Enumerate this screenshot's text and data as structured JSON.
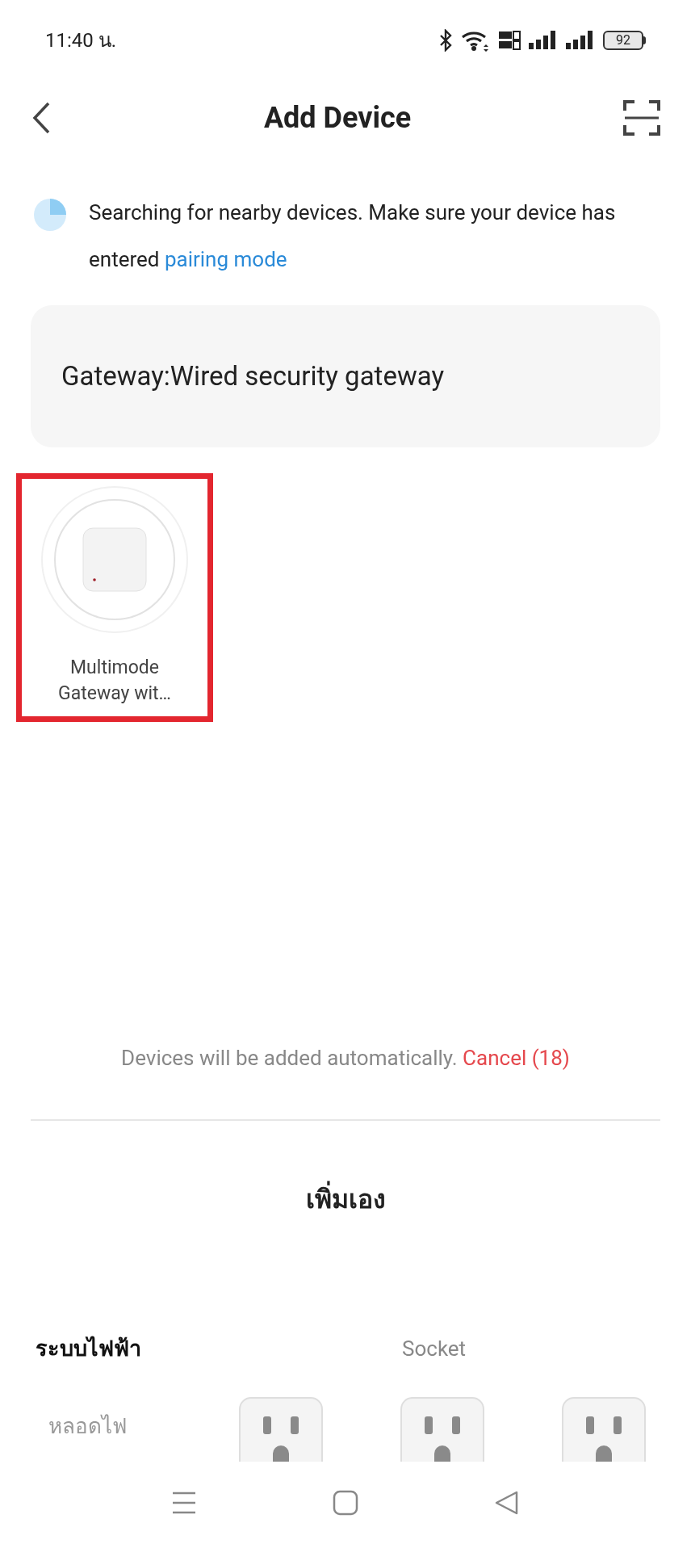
{
  "status_bar": {
    "time": "11:40 น.",
    "battery": "92"
  },
  "header": {
    "title": "Add Device"
  },
  "search_notice": {
    "text": "Searching for nearby devices. Make sure your device has entered",
    "link": "pairing mode"
  },
  "category_card": {
    "text": "Gateway:Wired security gateway"
  },
  "found_devices": [
    {
      "name": "Multimode Gateway wit…",
      "highlighted": true
    }
  ],
  "auto_add": {
    "text": "Devices will be added automatically.",
    "cancel": "Cancel (18)"
  },
  "manual_title": "เพิ่มเอง",
  "sidebar": {
    "items": [
      {
        "label": "ระบบไฟฟ้า",
        "selected": true
      },
      {
        "label": "หลอดไฟ",
        "selected": false
      }
    ]
  },
  "products": {
    "group_title": "Socket",
    "items": [
      {
        "kind": "socket"
      },
      {
        "kind": "socket"
      },
      {
        "kind": "socket"
      }
    ]
  }
}
